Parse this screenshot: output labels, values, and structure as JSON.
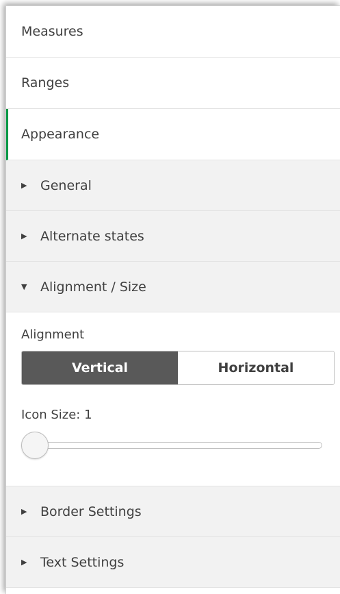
{
  "sections": {
    "measures": "Measures",
    "ranges": "Ranges",
    "appearance": "Appearance"
  },
  "appearance": {
    "general": {
      "label": "General",
      "caret": "▶"
    },
    "alternate_states": {
      "label": "Alternate states",
      "caret": "▶"
    },
    "alignment_size": {
      "label": "Alignment / Size",
      "caret": "▼",
      "alignment_label": "Alignment",
      "vertical_label": "Vertical",
      "horizontal_label": "Horizontal",
      "selected_alignment": "Vertical",
      "icon_size_label": "Icon Size: 1",
      "icon_size_value": 1
    },
    "border_settings": {
      "label": "Border Settings",
      "caret": "▶"
    },
    "text_settings": {
      "label": "Text Settings",
      "caret": "▶"
    }
  },
  "colors": {
    "active_accent": "#009845",
    "selected_button_bg": "#595959",
    "subsection_bg": "#f2f2f2"
  }
}
